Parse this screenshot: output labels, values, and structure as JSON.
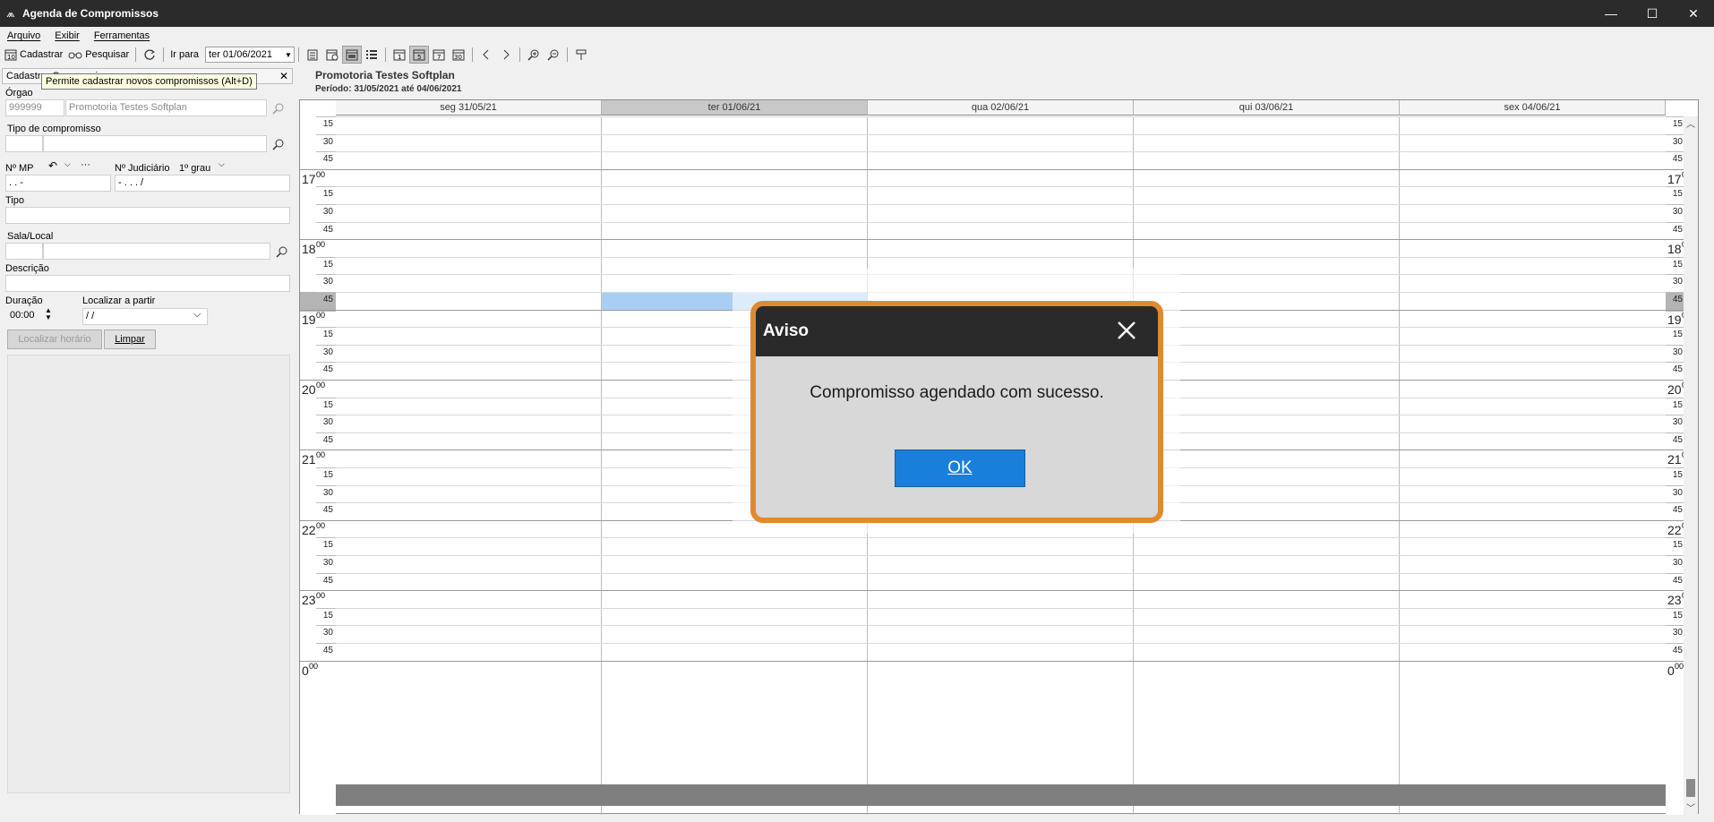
{
  "window": {
    "title": "Agenda de Compromissos"
  },
  "menu": [
    "Arquivo",
    "Exibir",
    "Ferramentas"
  ],
  "toolbar": {
    "cadastrar_label": "Cadastrar",
    "pesquisar_label": "Pesquisar",
    "ir_para_label": "Ir para",
    "date_value": "ter 01/06/2021"
  },
  "tooltip": "Permite cadastrar novos compromissos (Alt+D)",
  "panel": {
    "header": "Cadastrar Compromisso",
    "orgao_label": "Órgao",
    "orgao_code": "999999",
    "orgao_name": "Promotoria Testes Softplan",
    "tipo_comp_label": "Tipo de compromisso",
    "nmp_label": "Nº MP",
    "nmp_value": "  .  .   -",
    "njud_label": "Nº Judiciário",
    "grau_label": "1º grau",
    "njud_value": "  -  .  .  .  /",
    "tipo_label": "Tipo",
    "sala_label": "Sala/Local",
    "descricao_label": "Descrição",
    "duracao_label": "Duração",
    "duracao_value": "00:00",
    "localizar_partir_label": "Localizar a partir",
    "localizar_partir_value": " / /",
    "localizar_horario_btn": "Localizar horário",
    "limpar_btn": "Limpar"
  },
  "calendar": {
    "title": "Promotoria Testes Softplan",
    "period": "Período: 31/05/2021 até 04/06/2021",
    "days": [
      "seg 31/05/21",
      "ter 01/06/21",
      "qua 02/06/21",
      "qui 03/06/21",
      "sex 04/06/21"
    ],
    "hours": [
      "17",
      "18",
      "19",
      "20",
      "21",
      "22",
      "23"
    ],
    "last_hour": "0",
    "minutes": [
      "15",
      "30",
      "45"
    ],
    "hour_suffix": "00"
  },
  "dialog": {
    "title": "Aviso",
    "message": "Compromisso agendado com sucesso.",
    "ok": "OK"
  }
}
